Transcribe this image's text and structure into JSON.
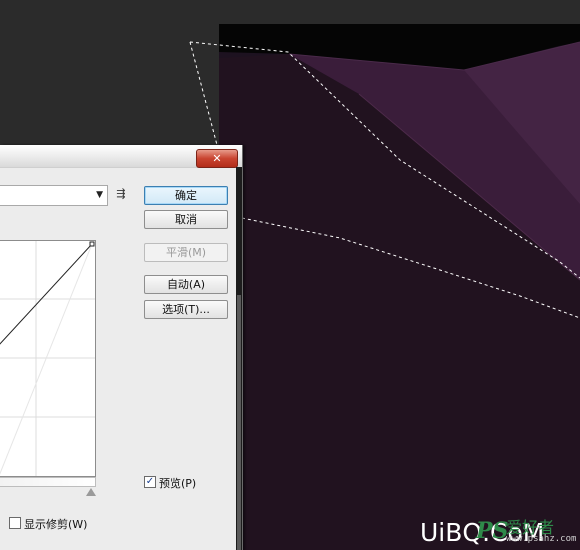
{
  "dialog": {
    "close_label": "✕",
    "preset_value": "",
    "preset_menu_icon": "⇶",
    "buttons": {
      "ok": "确定",
      "cancel": "取消",
      "smooth": "平滑(M)",
      "auto": "自动(A)",
      "options": "选项(T)..."
    },
    "preview": {
      "label": "预览(P)",
      "checked": true
    },
    "show_clipping": {
      "label": "显示修剪(W)",
      "checked": false
    }
  },
  "watermark": {
    "brand": "UiBQ.CoM",
    "ps_logo": "PS",
    "cn_text": "爱好者",
    "site": "www.psahz.com"
  },
  "colors": {
    "background": "#2b2b2b",
    "canvas_dark": "#1d1220",
    "canvas_light": "#3c1f3c",
    "dialog_bg": "#ececec",
    "close_red": "#c94430",
    "default_button_border": "#3c7fb1"
  },
  "icons": {
    "close": "close-icon",
    "preset_dropdown": "chevron-down-icon",
    "preset_menu": "preset-menu-icon",
    "preview_check": "checkmark-icon",
    "slider": "slider-handle-icon"
  }
}
